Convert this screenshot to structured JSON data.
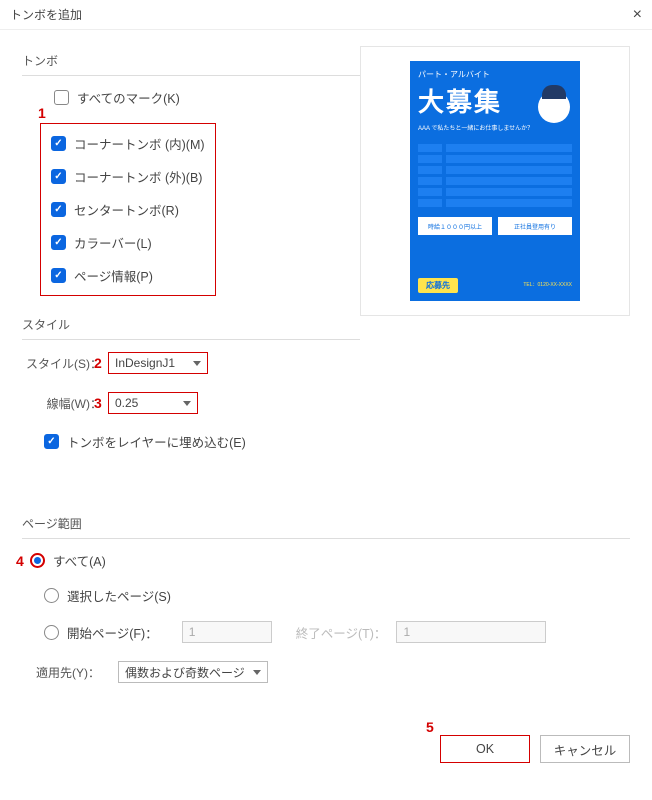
{
  "title": "トンボを追加",
  "markers": {
    "section": "トンボ",
    "allMarks": "すべてのマーク(K)",
    "cornerInner": "コーナートンボ (内)(M)",
    "cornerOuter": "コーナートンボ (外)(B)",
    "center": "センタートンボ(R)",
    "colorBar": "カラーバー(L)",
    "pageInfo": "ページ情報(P)"
  },
  "style": {
    "section": "スタイル",
    "styleLabel": "スタイル(S)：",
    "styleValue": "InDesignJ1",
    "lineWidthLabel": "線幅(W)：",
    "lineWidthValue": "0.25",
    "embedLayer": "トンボをレイヤーに埋め込む(E)"
  },
  "pageRange": {
    "section": "ページ範囲",
    "all": "すべて(A)",
    "selected": "選択したページ(S)",
    "startLabel": "開始ページ(F)：",
    "startValue": "1",
    "endLabel": "終了ページ(T)：",
    "endValue": "1",
    "applyToLabel": "適用先(Y)：",
    "applyToValue": "偶数および奇数ページ"
  },
  "buttons": {
    "ok": "OK",
    "cancel": "キャンセル"
  },
  "annotations": {
    "a1": "1",
    "a2": "2",
    "a3": "3",
    "a4": "4",
    "a5": "5"
  },
  "flyer": {
    "sub": "パート・アルバイト",
    "big": "大募集",
    "note": "AAA で私たちと一緒にお仕事しませんか？",
    "box1": "時給１０００円以上",
    "box2": "正社員登用有り",
    "pill": "応募先",
    "tel": "TEL：0120-XX-XXXX"
  }
}
